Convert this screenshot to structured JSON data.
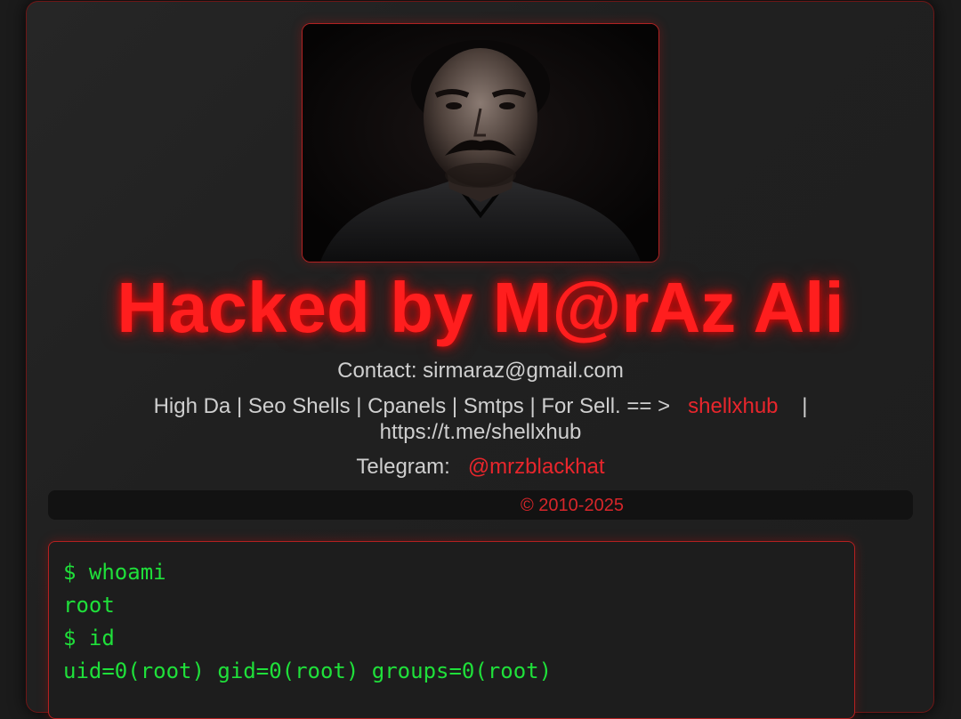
{
  "title": "Hacked by M@rAz Ali",
  "contact": {
    "text": "Contact: sirmaraz@gmail.com"
  },
  "sell": {
    "prefix": "High Da | Seo Shells | Cpanels | Smtps | For Sell. == >",
    "link": "shellxhub",
    "separator": "|",
    "url": "https://t.me/shellxhub"
  },
  "telegram": {
    "label": "Telegram:",
    "handle": "@mrzblackhat"
  },
  "footer": {
    "copyright": "© 2010-2025"
  },
  "terminal": {
    "lines": [
      "$ whoami",
      "root",
      "$ id",
      "uid=0(root) gid=0(root) groups=0(root)"
    ]
  },
  "colors": {
    "accent_red": "#ff1e1e",
    "terminal_green": "#1fe03a",
    "background": "#1b1b1b"
  },
  "image": {
    "icon": "portrait-photo"
  }
}
